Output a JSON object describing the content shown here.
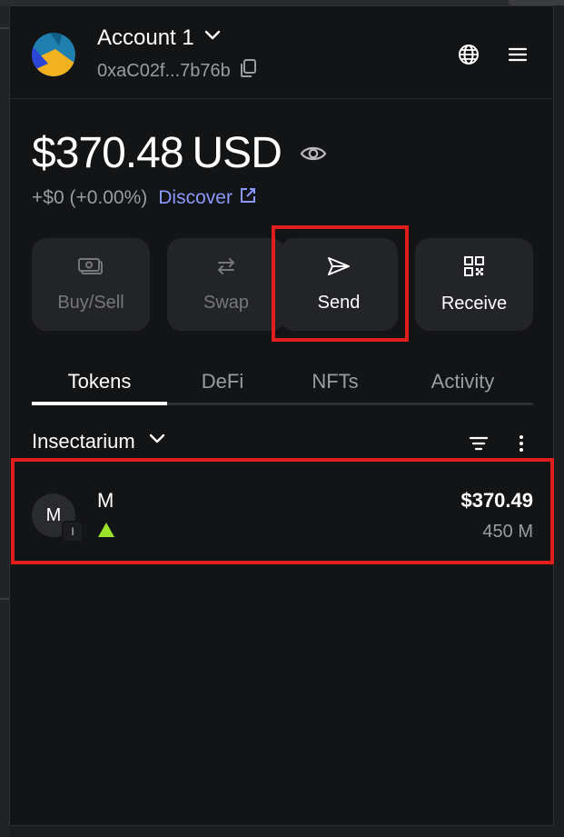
{
  "header": {
    "account_name": "Account 1",
    "account_address": "0xaC02f...7b76b",
    "icons": [
      "chevron-down-icon",
      "copy-icon",
      "globe-icon",
      "menu-icon"
    ]
  },
  "balance": {
    "amount": "$370.48",
    "currency": "USD",
    "change": "+$0 (+0.00%)",
    "discover_label": "Discover"
  },
  "actions": [
    {
      "label": "Buy/Sell",
      "icon": "cash-icon",
      "enabled": false
    },
    {
      "label": "Swap",
      "icon": "swap-arrows-icon",
      "enabled": false
    },
    {
      "label": "Send",
      "icon": "send-icon",
      "enabled": true
    },
    {
      "label": "Receive",
      "icon": "qr-code-icon",
      "enabled": true
    }
  ],
  "tabs": [
    {
      "label": "Tokens",
      "active": true
    },
    {
      "label": "DeFi",
      "active": false
    },
    {
      "label": "NFTs",
      "active": false
    },
    {
      "label": "Activity",
      "active": false
    }
  ],
  "network": {
    "label": "Insectarium"
  },
  "tokens": [
    {
      "avatar_letter": "M",
      "badge_letter": "I",
      "name": "M",
      "value": "$370.49",
      "amount": "450 M",
      "trend": "up"
    }
  ],
  "colors": {
    "background": "#131416",
    "accent_link": "#8b99ff",
    "highlight": "#e01e1e",
    "trend_up": "#9be32b"
  }
}
